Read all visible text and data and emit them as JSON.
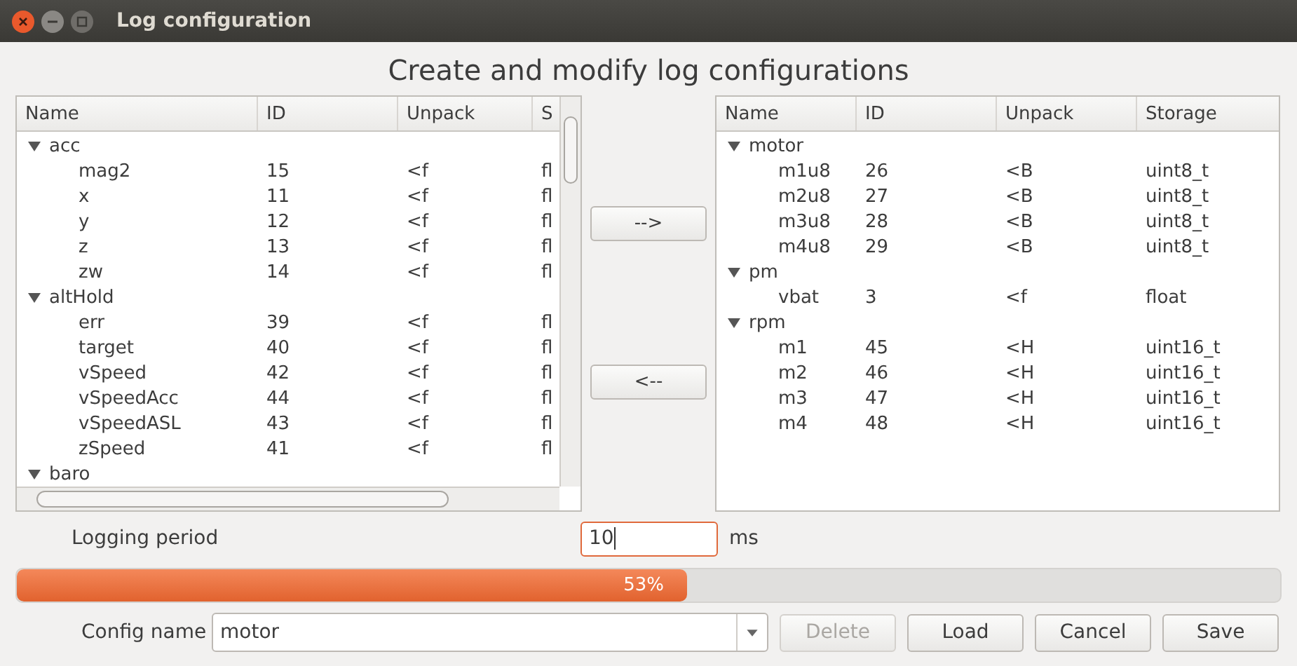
{
  "window": {
    "title": "Log configuration"
  },
  "heading": "Create and modify log configurations",
  "available": {
    "columns": [
      "Name",
      "ID",
      "Unpack",
      "S"
    ],
    "groups": [
      {
        "name": "acc",
        "expanded": true,
        "children": [
          {
            "name": "mag2",
            "id": "15",
            "unpack": "<f",
            "storage": "fl"
          },
          {
            "name": "x",
            "id": "11",
            "unpack": "<f",
            "storage": "fl"
          },
          {
            "name": "y",
            "id": "12",
            "unpack": "<f",
            "storage": "fl"
          },
          {
            "name": "z",
            "id": "13",
            "unpack": "<f",
            "storage": "fl"
          },
          {
            "name": "zw",
            "id": "14",
            "unpack": "<f",
            "storage": "fl"
          }
        ]
      },
      {
        "name": "altHold",
        "expanded": true,
        "children": [
          {
            "name": "err",
            "id": "39",
            "unpack": "<f",
            "storage": "fl"
          },
          {
            "name": "target",
            "id": "40",
            "unpack": "<f",
            "storage": "fl"
          },
          {
            "name": "vSpeed",
            "id": "42",
            "unpack": "<f",
            "storage": "fl"
          },
          {
            "name": "vSpeedAcc",
            "id": "44",
            "unpack": "<f",
            "storage": "fl"
          },
          {
            "name": "vSpeedASL",
            "id": "43",
            "unpack": "<f",
            "storage": "fl"
          },
          {
            "name": "zSpeed",
            "id": "41",
            "unpack": "<f",
            "storage": "fl"
          }
        ]
      },
      {
        "name": "baro",
        "expanded": true
      }
    ]
  },
  "add_button": "-->",
  "remove_button": "<--",
  "selected": {
    "columns": [
      "Name",
      "ID",
      "Unpack",
      "Storage"
    ],
    "groups": [
      {
        "name": "motor",
        "expanded": true,
        "children": [
          {
            "name": "m1u8",
            "id": "26",
            "unpack": "<B",
            "storage": "uint8_t"
          },
          {
            "name": "m2u8",
            "id": "27",
            "unpack": "<B",
            "storage": "uint8_t"
          },
          {
            "name": "m3u8",
            "id": "28",
            "unpack": "<B",
            "storage": "uint8_t"
          },
          {
            "name": "m4u8",
            "id": "29",
            "unpack": "<B",
            "storage": "uint8_t"
          }
        ]
      },
      {
        "name": "pm",
        "expanded": true,
        "children": [
          {
            "name": "vbat",
            "id": "3",
            "unpack": "<f",
            "storage": "float"
          }
        ]
      },
      {
        "name": "rpm",
        "expanded": true,
        "children": [
          {
            "name": "m1",
            "id": "45",
            "unpack": "<H",
            "storage": "uint16_t"
          },
          {
            "name": "m2",
            "id": "46",
            "unpack": "<H",
            "storage": "uint16_t"
          },
          {
            "name": "m3",
            "id": "47",
            "unpack": "<H",
            "storage": "uint16_t"
          },
          {
            "name": "m4",
            "id": "48",
            "unpack": "<H",
            "storage": "uint16_t"
          }
        ]
      }
    ]
  },
  "period": {
    "label": "Logging period",
    "value": "10",
    "unit": "ms"
  },
  "progress": {
    "level": 0.53,
    "reading": "53%"
  },
  "config": {
    "label": "Config name",
    "value": "motor"
  },
  "buttons": [
    {
      "label": "Delete",
      "disabled": true
    },
    {
      "label": "Load",
      "disabled": false
    },
    {
      "label": "Cancel",
      "disabled": false
    },
    {
      "label": "Save",
      "disabled": false
    }
  ]
}
